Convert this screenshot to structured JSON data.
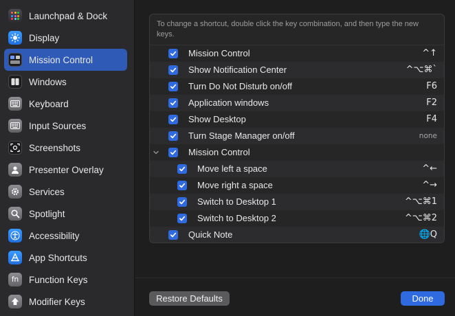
{
  "sidebar": {
    "items": [
      {
        "label": "Launchpad & Dock",
        "icon": "launchpad-icon"
      },
      {
        "label": "Display",
        "icon": "display-icon"
      },
      {
        "label": "Mission Control",
        "icon": "mission-control-icon",
        "selected": true
      },
      {
        "label": "Windows",
        "icon": "windows-icon"
      },
      {
        "label": "Keyboard",
        "icon": "keyboard-icon"
      },
      {
        "label": "Input Sources",
        "icon": "input-sources-icon"
      },
      {
        "label": "Screenshots",
        "icon": "screenshots-icon"
      },
      {
        "label": "Presenter Overlay",
        "icon": "presenter-overlay-icon"
      },
      {
        "label": "Services",
        "icon": "services-icon"
      },
      {
        "label": "Spotlight",
        "icon": "spotlight-icon"
      },
      {
        "label": "Accessibility",
        "icon": "accessibility-icon"
      },
      {
        "label": "App Shortcuts",
        "icon": "app-shortcuts-icon"
      },
      {
        "label": "Function Keys",
        "icon": "function-keys-icon",
        "glyph": "fn"
      },
      {
        "label": "Modifier Keys",
        "icon": "modifier-keys-icon"
      }
    ]
  },
  "main": {
    "hint": "To change a shortcut, double click the key combination, and then type the new keys.",
    "rows": [
      {
        "label": "Mission Control",
        "key": "^↑",
        "checked": true,
        "indent": 0
      },
      {
        "label": "Show Notification Center",
        "key": "^⌥⌘`",
        "checked": true,
        "indent": 0
      },
      {
        "label": "Turn Do Not Disturb on/off",
        "key": "F6",
        "checked": true,
        "indent": 0
      },
      {
        "label": "Application windows",
        "key": "F2",
        "checked": true,
        "indent": 0
      },
      {
        "label": "Show Desktop",
        "key": "F4",
        "checked": true,
        "indent": 0
      },
      {
        "label": "Turn Stage Manager on/off",
        "key": "none",
        "checked": true,
        "indent": 0
      },
      {
        "label": "Mission Control",
        "key": "",
        "checked": true,
        "indent": 0,
        "expanded": true
      },
      {
        "label": "Move left a space",
        "key": "^←",
        "checked": true,
        "indent": 1
      },
      {
        "label": "Move right a space",
        "key": "^→",
        "checked": true,
        "indent": 1
      },
      {
        "label": "Switch to Desktop 1",
        "key": "^⌥⌘1",
        "checked": true,
        "indent": 1
      },
      {
        "label": "Switch to Desktop 2",
        "key": "^⌥⌘2",
        "checked": true,
        "indent": 1
      },
      {
        "label": "Quick Note",
        "key": "🌐Q",
        "checked": true,
        "indent": 0
      }
    ]
  },
  "buttons": {
    "restore": "Restore Defaults",
    "done": "Done"
  },
  "colors": {
    "accent": "#2f6ae0",
    "sidebar_selected": "#2f5bb6"
  }
}
